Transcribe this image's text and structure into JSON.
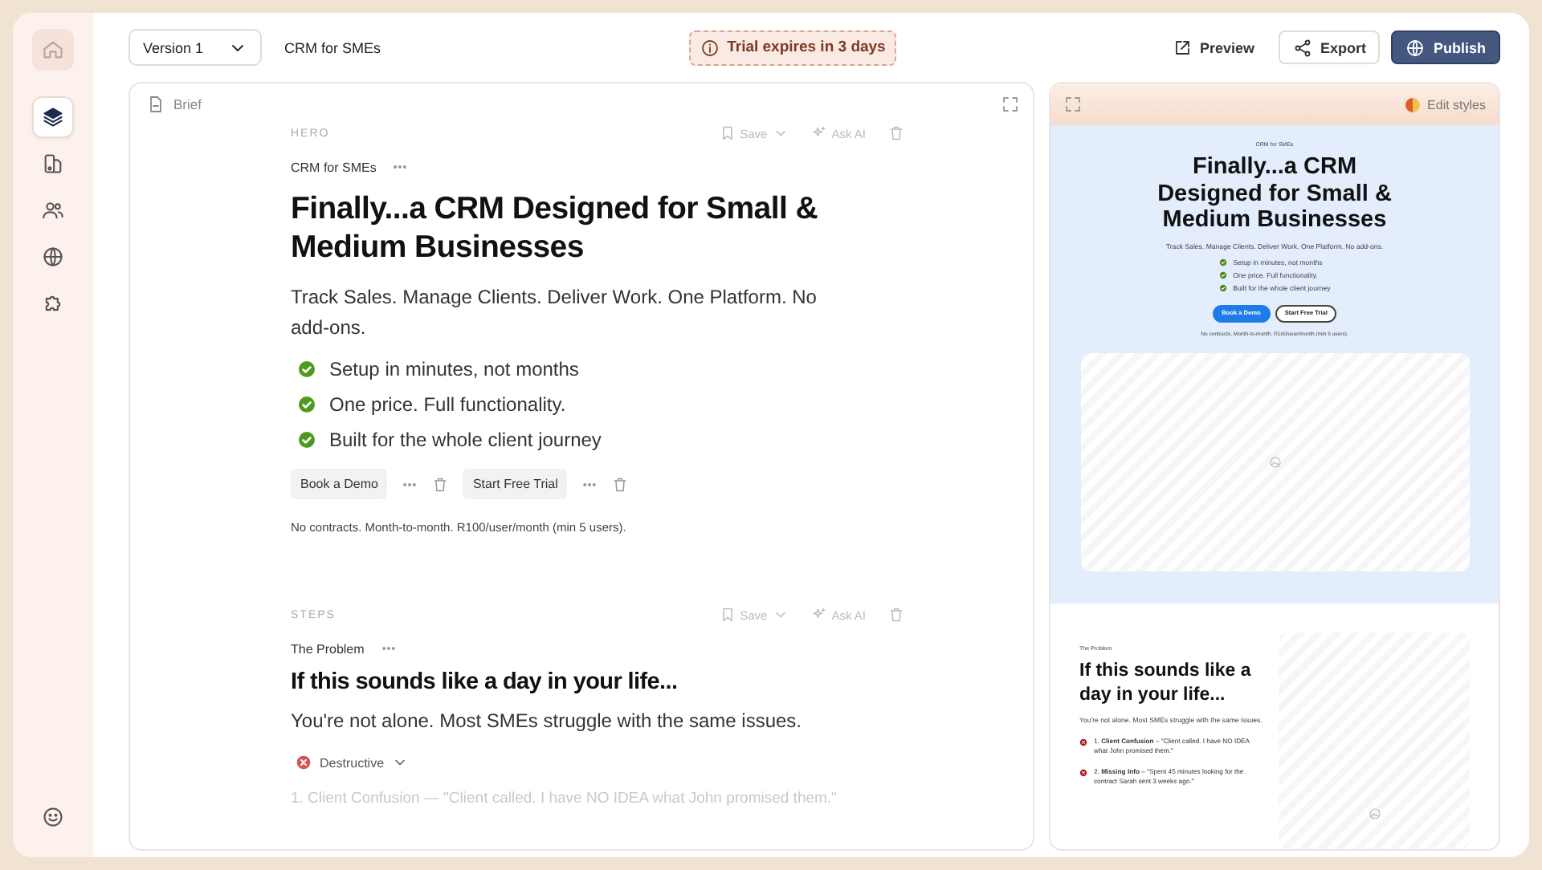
{
  "sidebar": {
    "home": {
      "selected": false
    },
    "items": [
      {
        "selected": true
      },
      {
        "selected": false
      },
      {
        "selected": false
      },
      {
        "selected": false
      },
      {
        "selected": false
      }
    ]
  },
  "topbar": {
    "version_select": "Version 1",
    "project_name": "CRM for SMEs",
    "trial_badge": "Trial expires in 3 days",
    "actions": [
      {
        "kind": "link",
        "label": "Preview"
      },
      {
        "kind": "outline",
        "label": "Export"
      },
      {
        "kind": "primary",
        "label": "Publish"
      }
    ]
  },
  "editor": {
    "brief": "Brief",
    "sections": [
      {
        "kind": "hero",
        "label": "HERO",
        "save": "Save",
        "ask_ai": "Ask AI",
        "eyebrow": "CRM for SMEs",
        "heading": "Finally...a CRM Designed for Small & Medium Businesses",
        "subtitle": "Track Sales. Manage Clients. Deliver Work. One Platform. No add-ons.",
        "bullets": [
          "Setup in minutes, not months",
          "One price. Full functionality.",
          "Built for the whole client journey"
        ],
        "buttons": [
          "Book a Demo",
          "Start Free Trial"
        ],
        "note": "No contracts. Month-to-month. R100/user/month (min 5 users)."
      },
      {
        "kind": "steps",
        "label": "STEPS",
        "save": "Save",
        "ask_ai": "Ask AI",
        "eyebrow": "The Problem",
        "heading": "If this sounds like a day in your life...",
        "subtitle": "You're not alone. Most SMEs struggle with the same issues.",
        "variant": {
          "label": "Destructive",
          "color": "#d65454"
        },
        "items": [
          "1. Client Confusion — \"Client called. I have NO IDEA what John promised them.\""
        ]
      }
    ]
  },
  "preview": {
    "edit_styles": "Edit styles",
    "hero": {
      "eyebrow": "CRM for SMEs",
      "heading": "Finally...a CRM Designed for Small & Medium Businesses",
      "subtitle": "Track Sales. Manage Clients. Deliver Work. One Platform. No add-ons.",
      "bullets": [
        "Setup in minutes, not months",
        "One price. Full functionality.",
        "Built for the whole client journey"
      ],
      "buttons": [
        {
          "label": "Book a Demo",
          "kind": "primary"
        },
        {
          "label": "Start Free Trial",
          "kind": "outline"
        }
      ],
      "note": "No contracts. Month-to-month. R100/user/month (min 5 users)."
    },
    "problem": {
      "eyebrow": "The Problem",
      "heading": "If this sounds like a day in your life...",
      "subtitle": "You're not alone. Most SMEs struggle with the same issues.",
      "items": [
        "1. **Client Confusion** – \"Client called. I have NO IDEA what John promised them.\"",
        "2. **Missing Info** – \"Spent 45 minutes looking for the contract Sarah sent 3 weeks ago.\""
      ]
    }
  }
}
